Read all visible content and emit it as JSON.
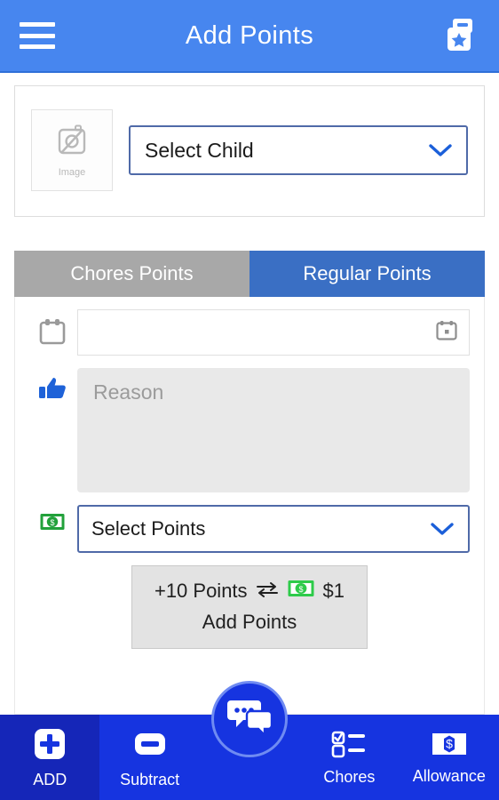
{
  "header": {
    "title": "Add Points",
    "menu_icon": "hamburger-menu-icon",
    "right_icon": "lock-star-icon"
  },
  "child_card": {
    "image_placeholder_label": "Image",
    "image_icon": "broken-image-icon",
    "select_child_value": "Select Child",
    "chevron_icon": "chevron-down-icon"
  },
  "tabs": [
    {
      "label": "Chores Points",
      "active": false
    },
    {
      "label": "Regular Points",
      "active": true
    }
  ],
  "form": {
    "date_row": {
      "lead_icon": "calendar-icon",
      "value": "",
      "placeholder": "",
      "picker_icon": "calendar-picker-icon"
    },
    "reason_row": {
      "lead_icon": "thumbs-up-icon",
      "value": "",
      "placeholder": "Reason"
    },
    "points_row": {
      "lead_icon": "money-bill-icon",
      "value": "Select Points",
      "chevron_icon": "chevron-down-icon"
    }
  },
  "add_button": {
    "points_text": "+10 Points",
    "exchange_icon": "exchange-arrows-icon",
    "money_icon": "money-bill-icon",
    "amount_text": "$1",
    "action_label": "Add Points"
  },
  "bottom_nav": [
    {
      "label": "ADD",
      "icon": "plus-square-icon",
      "active": true
    },
    {
      "label": "Subtract",
      "icon": "minus-square-icon",
      "active": false
    },
    {
      "label": "",
      "icon": "chat-bubbles-icon",
      "active": false
    },
    {
      "label": "Chores",
      "icon": "checklist-icon",
      "active": false
    },
    {
      "label": "Allowance",
      "icon": "dollar-bill-icon",
      "active": false
    }
  ],
  "colors": {
    "header_blue": "#4786ef",
    "tab_active_blue": "#3a6fc4",
    "tab_inactive_gray": "#a8a8a8",
    "nav_blue": "#1634e0",
    "nav_active_blue": "#1526b8",
    "money_green": "#22a13b",
    "thumb_blue": "#1e62d8",
    "select_border": "#4f6aa8"
  }
}
